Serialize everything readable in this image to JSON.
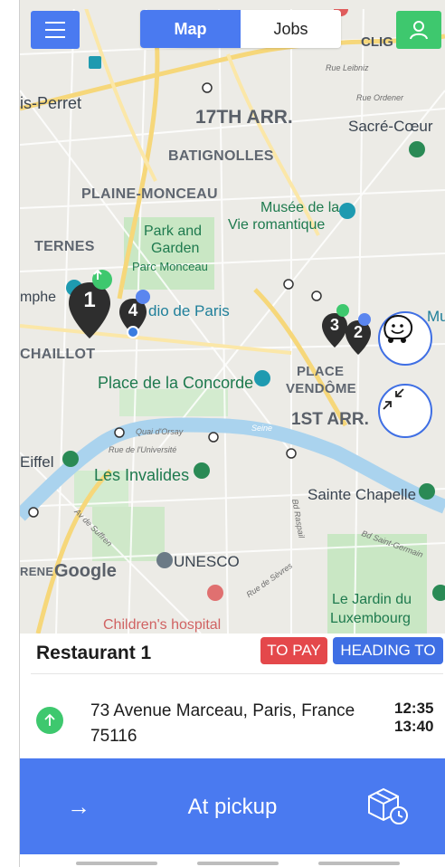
{
  "header": {
    "tabs": [
      {
        "label": "Map",
        "active": true
      },
      {
        "label": "Jobs",
        "active": false
      }
    ],
    "menu_icon": "hamburger-menu-icon",
    "user_icon": "user-icon"
  },
  "map": {
    "labels": {
      "clig": "CLIG",
      "rue_leibniz": "Rue Leibniz",
      "rue_ordener": "Rue Ordener",
      "levallois": "is-Perret",
      "arr17": "17TH ARR.",
      "sacre_coeur": "Sacré-Cœur",
      "batignolles": "BATIGNOLLES",
      "plaine_monceau": "PLAINE-MONCEAU",
      "musee1": "Musée de la",
      "musee2": "Vie romantique",
      "park1": "Park and",
      "park2": "Garden",
      "parc_monceau": "Parc Monceau",
      "ternes": "TERNES",
      "mphe": "mphe",
      "dio": "dio de Paris",
      "mu": "Mu",
      "chaillot": "CHAILLOT",
      "place1": "PLACE",
      "place2": "VENDÔME",
      "concorde": "Place de la Concorde",
      "arr1": "1ST ARR.",
      "quai": "Quai d'Orsay",
      "seine": "Seine",
      "rue_univ": "Rue de l'Université",
      "eiffel": "Eiffel",
      "invalides": "Les Invalides",
      "sainte": "Sainte Chapelle",
      "av_suffren": "Av de Suffren",
      "bd_raspail": "Bd Raspail",
      "bd_sg": "Bd Saint-Germain",
      "unesco": "UNESCO",
      "rue_sevres": "Rue de Sèvres",
      "renel": "RENE",
      "google": "Google",
      "jardin1": "Le Jardin du",
      "jardin2": "Luxembourg",
      "childrens": "Children's hospital"
    },
    "markers": [
      {
        "number": "1",
        "status": "pickup"
      },
      {
        "number": "4",
        "status": "dropoff"
      },
      {
        "number": "3",
        "status": "pickup"
      },
      {
        "number": "2",
        "status": "dropoff"
      }
    ],
    "waze_icon": "waze-icon",
    "collapse_icon": "collapse-arrows-icon"
  },
  "job": {
    "title": "Restaurant 1",
    "badge_pay": "TO PAY",
    "badge_status": "HEADING TO",
    "address": "73 Avenue Marceau, Paris, France 75116",
    "time_start": "12:35",
    "time_end": "13:40",
    "action_label": "At pickup"
  },
  "colors": {
    "primary": "#4a7af0",
    "success": "#3ec86e",
    "danger": "#e4484b"
  }
}
